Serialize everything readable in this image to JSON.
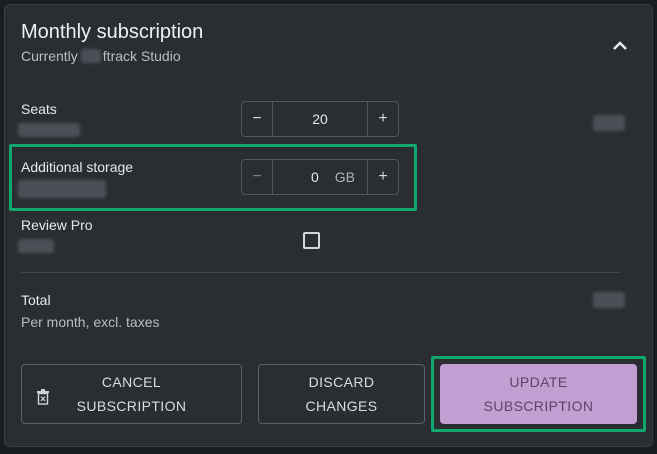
{
  "subscription": {
    "title": "Monthly subscription",
    "currently_prefix": "Currently",
    "plan_name": "ftrack Studio"
  },
  "rows": {
    "seats": {
      "label": "Seats",
      "value": "20"
    },
    "storage": {
      "label": "Additional storage",
      "value": "0",
      "unit": "GB"
    },
    "review_pro": {
      "label": "Review Pro",
      "checked": false
    },
    "total": {
      "label": "Total",
      "note": "Per month, excl. taxes"
    }
  },
  "stepper_icons": {
    "minus": "−",
    "plus": "+"
  },
  "buttons": {
    "cancel": {
      "line1": "CANCEL",
      "line2": "SUBSCRIPTION"
    },
    "discard": {
      "line1": "DISCARD",
      "line2": "CHANGES"
    },
    "update": {
      "line1": "UPDATE",
      "line2": "SUBSCRIPTION"
    }
  },
  "colors": {
    "background": "#1b1e21",
    "card": "#2a2e33",
    "highlight": "#11a86d",
    "primary_button": "#c39ed3",
    "primary_text": "#5b4467"
  }
}
